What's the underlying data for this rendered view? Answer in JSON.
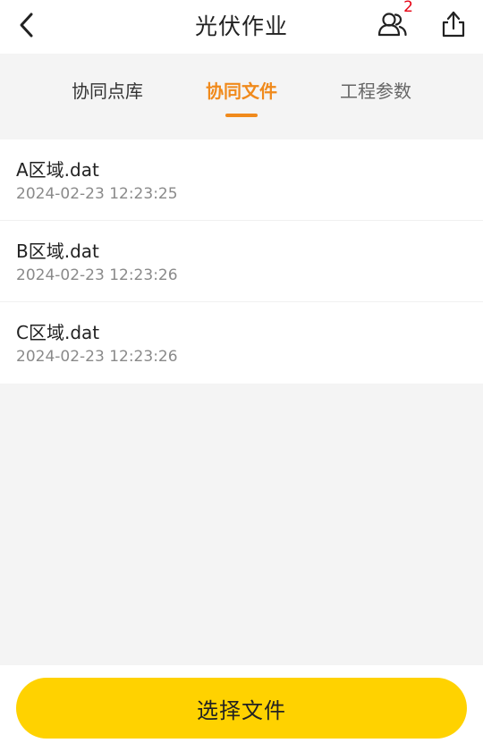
{
  "header": {
    "title": "光伏作业",
    "back_icon": "chevron-left-icon",
    "members_icon": "users-icon",
    "members_count": "2",
    "share_icon": "share-icon"
  },
  "tabs": [
    {
      "label": "协同点库",
      "active": false
    },
    {
      "label": "协同文件",
      "active": true
    },
    {
      "label": "工程参数",
      "active": false
    }
  ],
  "files": [
    {
      "name": "A区域.dat",
      "time": "2024-02-23 12:23:25"
    },
    {
      "name": "B区域.dat",
      "time": "2024-02-23 12:23:26"
    },
    {
      "name": "C区域.dat",
      "time": "2024-02-23 12:23:26"
    }
  ],
  "footer": {
    "select_label": "选择文件"
  },
  "colors": {
    "accent": "#f08a1c",
    "button": "#ffd200",
    "badge": "#e60012",
    "background": "#f4f4f4"
  }
}
